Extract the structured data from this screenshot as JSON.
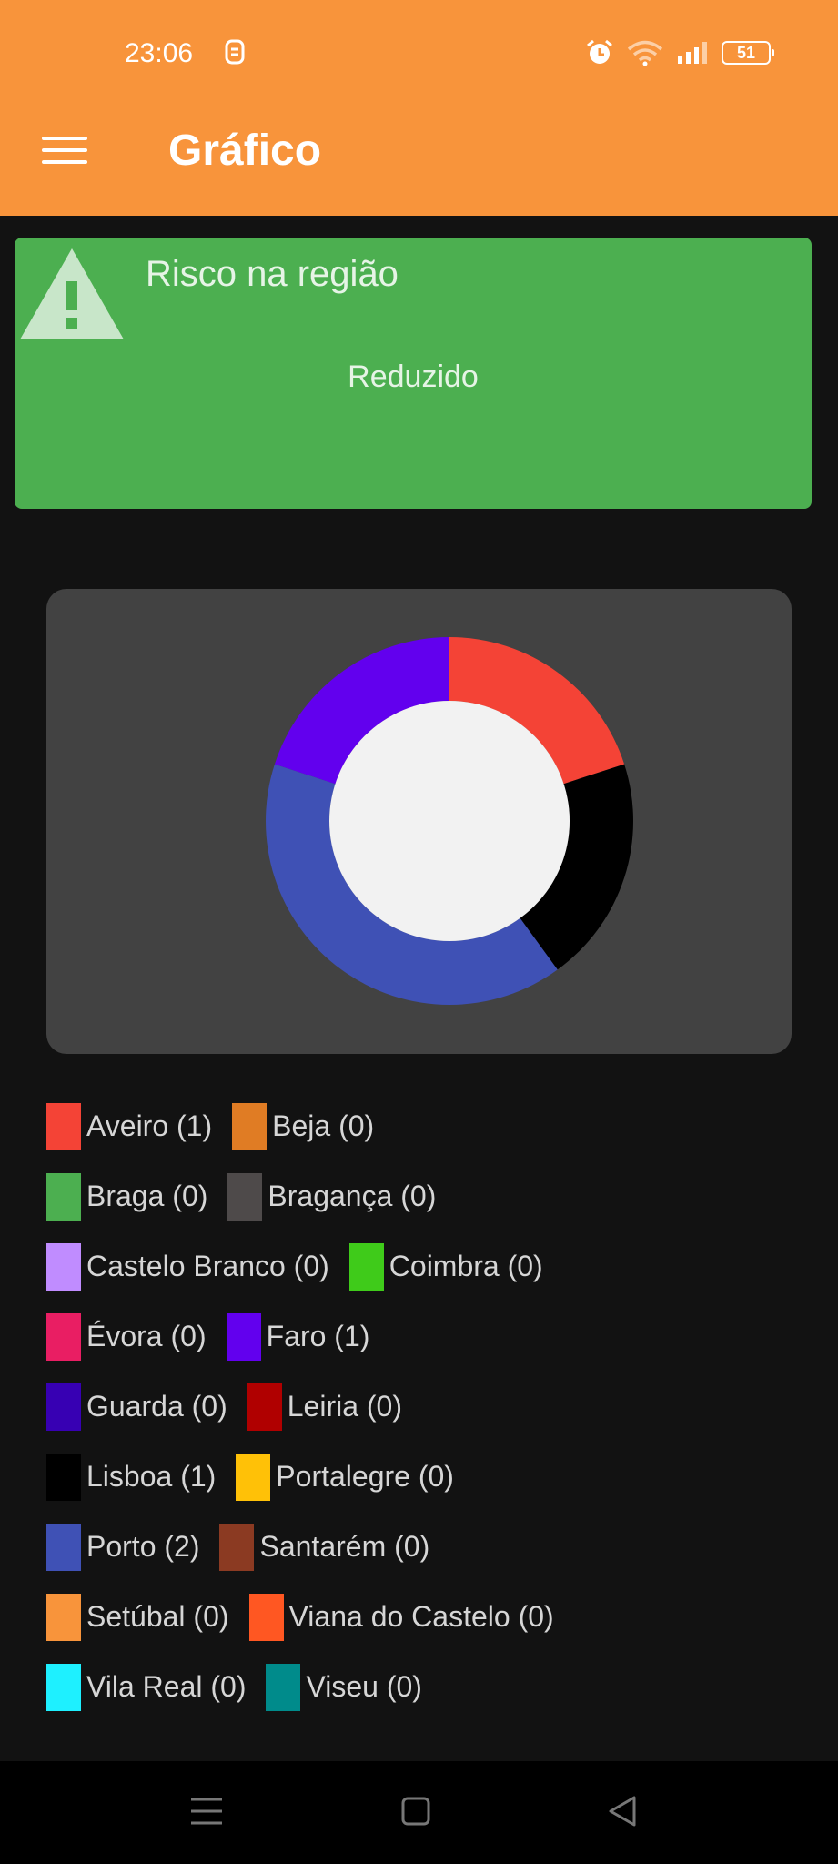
{
  "status": {
    "time": "23:06",
    "battery": "51"
  },
  "appbar": {
    "title": "Gráfico"
  },
  "risk": {
    "title": "Risco na região",
    "value": "Reduzido"
  },
  "chart_data": {
    "type": "pie",
    "categories": [
      "Aveiro",
      "Lisboa",
      "Porto",
      "Faro"
    ],
    "values": [
      1,
      1,
      2,
      1
    ],
    "colors": [
      "#F44336",
      "#000000",
      "#3F51B5",
      "#6200EE"
    ],
    "title": "",
    "hole_color": "#F2F2F2"
  },
  "legend": [
    [
      {
        "label": "Aveiro (1)",
        "color": "#F44336"
      },
      {
        "label": "Beja (0)",
        "color": "#E07C24"
      }
    ],
    [
      {
        "label": "Braga (0)",
        "color": "#4CAF50"
      },
      {
        "label": "Bragança (0)",
        "color": "#4E4A4A"
      }
    ],
    [
      {
        "label": "Castelo Branco (0)",
        "color": "#C08CFF"
      },
      {
        "label": "Coimbra (0)",
        "color": "#3FCB1A"
      }
    ],
    [
      {
        "label": "Évora (0)",
        "color": "#E91E63"
      },
      {
        "label": "Faro (1)",
        "color": "#6200EE"
      }
    ],
    [
      {
        "label": "Guarda (0)",
        "color": "#3700B3"
      },
      {
        "label": "Leiria (0)",
        "color": "#B00000"
      }
    ],
    [
      {
        "label": "Lisboa (1)",
        "color": "#000000"
      },
      {
        "label": "Portalegre (0)",
        "color": "#FFC107"
      }
    ],
    [
      {
        "label": "Porto (2)",
        "color": "#3F51B5"
      },
      {
        "label": "Santarém (0)",
        "color": "#8B3A22"
      }
    ],
    [
      {
        "label": "Setúbal (0)",
        "color": "#F8943B"
      },
      {
        "label": "Viana do Castelo (0)",
        "color": "#FF5722"
      }
    ],
    [
      {
        "label": "Vila Real (0)",
        "color": "#1EF0FF"
      },
      {
        "label": "Viseu (0)",
        "color": "#008B8B"
      }
    ]
  ]
}
